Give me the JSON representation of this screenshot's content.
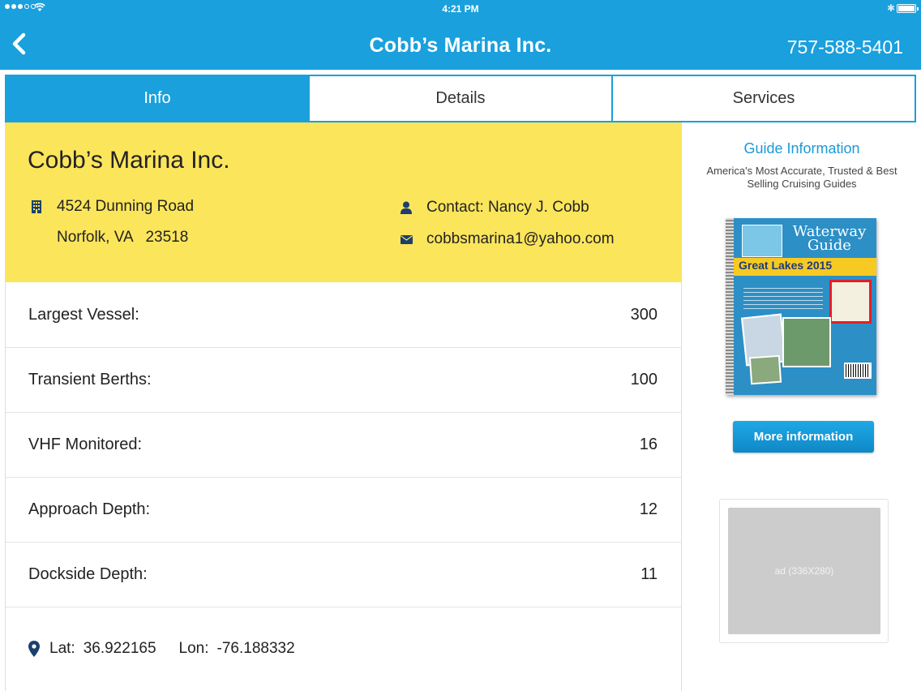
{
  "status_bar": {
    "time": "4:21 PM"
  },
  "nav": {
    "title": "Cobb’s Marina Inc.",
    "phone": "757-588-5401"
  },
  "tabs": [
    {
      "label": "Info",
      "active": true
    },
    {
      "label": "Details",
      "active": false
    },
    {
      "label": "Services",
      "active": false
    }
  ],
  "marina": {
    "name": "Cobb’s Marina Inc.",
    "address_line1": "4524 Dunning Road",
    "address_line2": "Norfolk, VA   23518",
    "contact": "Contact: Nancy J. Cobb",
    "email": "cobbsmarina1@yahoo.com"
  },
  "stats": [
    {
      "label": "Largest Vessel:",
      "value": "300"
    },
    {
      "label": "Transient Berths:",
      "value": "100"
    },
    {
      "label": "VHF Monitored:",
      "value": "16"
    },
    {
      "label": "Approach Depth:",
      "value": "12"
    },
    {
      "label": "Dockside Depth:",
      "value": "11"
    }
  ],
  "location": {
    "lat_label": "Lat:",
    "lat": "36.922165",
    "lon_label": "Lon:",
    "lon": "-76.188332"
  },
  "guide": {
    "title": "Guide Information",
    "subtitle": "America's Most Accurate, Trusted & Best Selling Cruising Guides",
    "book_brand": "Waterway Guide",
    "book_band": "Great Lakes 2015",
    "button_label": "More information"
  },
  "ad": {
    "label": "ad (336X280)"
  },
  "colors": {
    "primary": "#1aa0dd",
    "header_card": "#fbe55b",
    "icon": "#1c3f6e"
  }
}
